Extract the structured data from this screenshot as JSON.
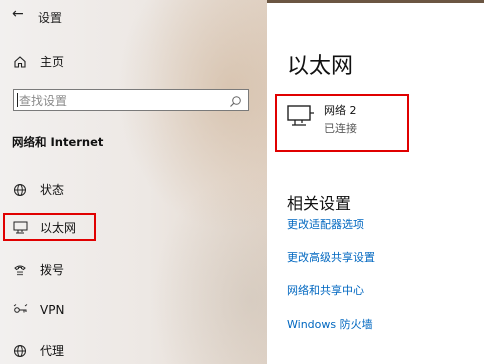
{
  "sidebar": {
    "back_glyph": "←",
    "title": "设置",
    "home_label": "主页",
    "search_placeholder": "查找设置",
    "section_title": "网络和 Internet",
    "items": [
      {
        "label": "状态",
        "icon": "globe-icon"
      },
      {
        "label": "以太网",
        "icon": "ethernet-icon"
      },
      {
        "label": "拨号",
        "icon": "phone-icon"
      },
      {
        "label": "VPN",
        "icon": "vpn-icon"
      },
      {
        "label": "代理",
        "icon": "globe-icon"
      }
    ],
    "active_item": "以太网"
  },
  "main": {
    "title": "以太网",
    "network": {
      "name": "网络 2",
      "status": "已连接",
      "icon": "ethernet-icon"
    },
    "related_title": "相关设置",
    "links": [
      "更改适配器选项",
      "更改高级共享设置",
      "网络和共享中心",
      "Windows 防火墙"
    ]
  },
  "colors": {
    "highlight_border": "#e00000",
    "link": "#0067c0"
  }
}
